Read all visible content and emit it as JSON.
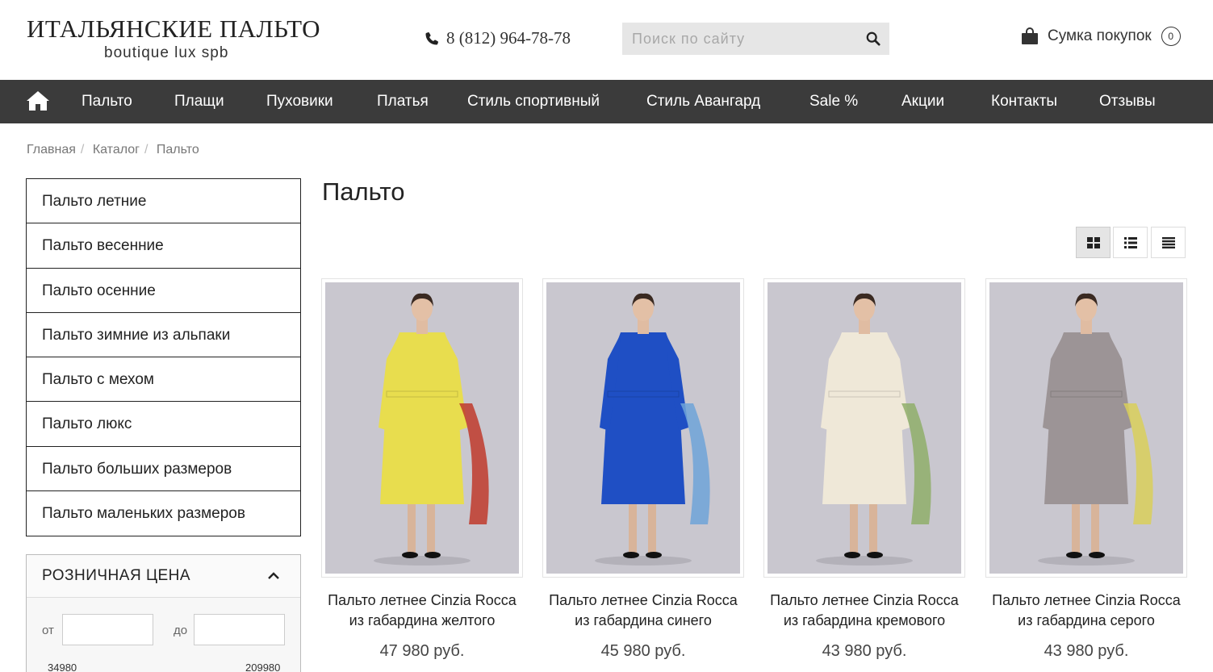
{
  "header": {
    "logo_title": "ИТАЛЬЯНСКИЕ ПАЛЬТО",
    "logo_subtitle": "boutique lux spb",
    "phone": "8 (812) 964-78-78",
    "search_placeholder": "Поиск по сайту",
    "cart_label": "Сумка покупок",
    "cart_count": "0"
  },
  "nav": {
    "items": [
      "Пальто",
      "Плащи",
      "Пуховики",
      "Платья",
      "Стиль спортивный",
      "Стиль Авангард",
      "Sale %",
      "Акции",
      "Контакты",
      "Отзывы"
    ]
  },
  "breadcrumb": {
    "items": [
      "Главная",
      "Каталог",
      "Пальто"
    ]
  },
  "sidebar": {
    "categories": [
      "Пальто летние",
      "Пальто весенние",
      "Пальто осенние",
      "Пальто зимние из альпаки",
      "Пальто с мехом",
      "Пальто люкс",
      "Пальто больших размеров",
      "Пальто маленьких размеров"
    ],
    "price_filter": {
      "title": "РОЗНИЧНАЯ ЦЕНА",
      "from_label": "от",
      "to_label": "до",
      "min_value": "34980",
      "max_value": "209980"
    }
  },
  "main": {
    "title": "Пальто",
    "products": [
      {
        "name_line1": "Пальто летнее Cinzia Rocca",
        "name_line2": "из габардина желтого",
        "price": "47 980 руб.",
        "coat_color": "#e8dd4e",
        "scarf_color": "#c0392b"
      },
      {
        "name_line1": "Пальто летнее Cinzia Rocca",
        "name_line2": "из габардина синего",
        "price": "45 980 руб.",
        "coat_color": "#1f4fc4",
        "scarf_color": "#6fa3d8"
      },
      {
        "name_line1": "Пальто летнее Cinzia Rocca",
        "name_line2": "из габардина кремового",
        "price": "43 980 руб.",
        "coat_color": "#efe8d8",
        "scarf_color": "#8fae6a"
      },
      {
        "name_line1": "Пальто летнее Cinzia Rocca",
        "name_line2": "из габардина серого",
        "price": "43 980 руб.",
        "coat_color": "#9c9496",
        "scarf_color": "#d9cf5a"
      }
    ]
  },
  "icons": {
    "phone": "phone-icon",
    "search": "search-icon",
    "cart": "shopping-bag-icon",
    "home": "home-icon",
    "collapse": "chevron-up-icon",
    "view_grid": "grid-view-icon",
    "view_list": "list-view-icon",
    "view_table": "table-view-icon"
  },
  "colors": {
    "nav_background": "#3b3b3b",
    "search_background": "#e6e6e6"
  }
}
